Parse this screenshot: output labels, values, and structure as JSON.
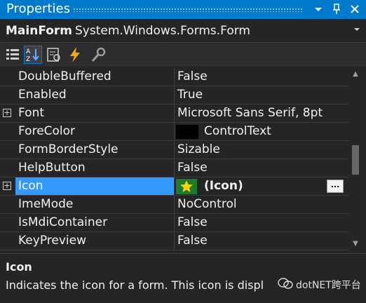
{
  "window": {
    "title": "Properties",
    "icons": [
      "chevron-down-icon",
      "pin-icon",
      "close-icon"
    ]
  },
  "object": {
    "name": "MainForm",
    "type": "System.Windows.Forms.Form"
  },
  "toolbar": {
    "buttons": [
      "categorized-icon",
      "alphabetical-icon",
      "properties-icon",
      "events-icon",
      "property-pages-icon"
    ]
  },
  "properties": [
    {
      "name": "DoubleBuffered",
      "value": "False"
    },
    {
      "name": "Enabled",
      "value": "True"
    },
    {
      "name": "Font",
      "value": "Microsoft Sans Serif, 8pt"
    },
    {
      "name": "ForeColor",
      "value": "ControlText"
    },
    {
      "name": "FormBorderStyle",
      "value": "Sizable"
    },
    {
      "name": "HelpButton",
      "value": "False"
    },
    {
      "name": "Icon",
      "value": "(Icon)"
    },
    {
      "name": "ImeMode",
      "value": "NoControl"
    },
    {
      "name": "IsMdiContainer",
      "value": "False"
    },
    {
      "name": "KeyPreview",
      "value": "False"
    }
  ],
  "icon_button_label": "...",
  "colors": {
    "accent": "#007acc",
    "selection": "#3399ff",
    "background": "#252526",
    "forecolor_swatch": "#000000"
  },
  "description": {
    "title": "Icon",
    "text": "Indicates the icon for a form. This icon is displ"
  },
  "watermark": {
    "text": "dotNET跨平台"
  }
}
